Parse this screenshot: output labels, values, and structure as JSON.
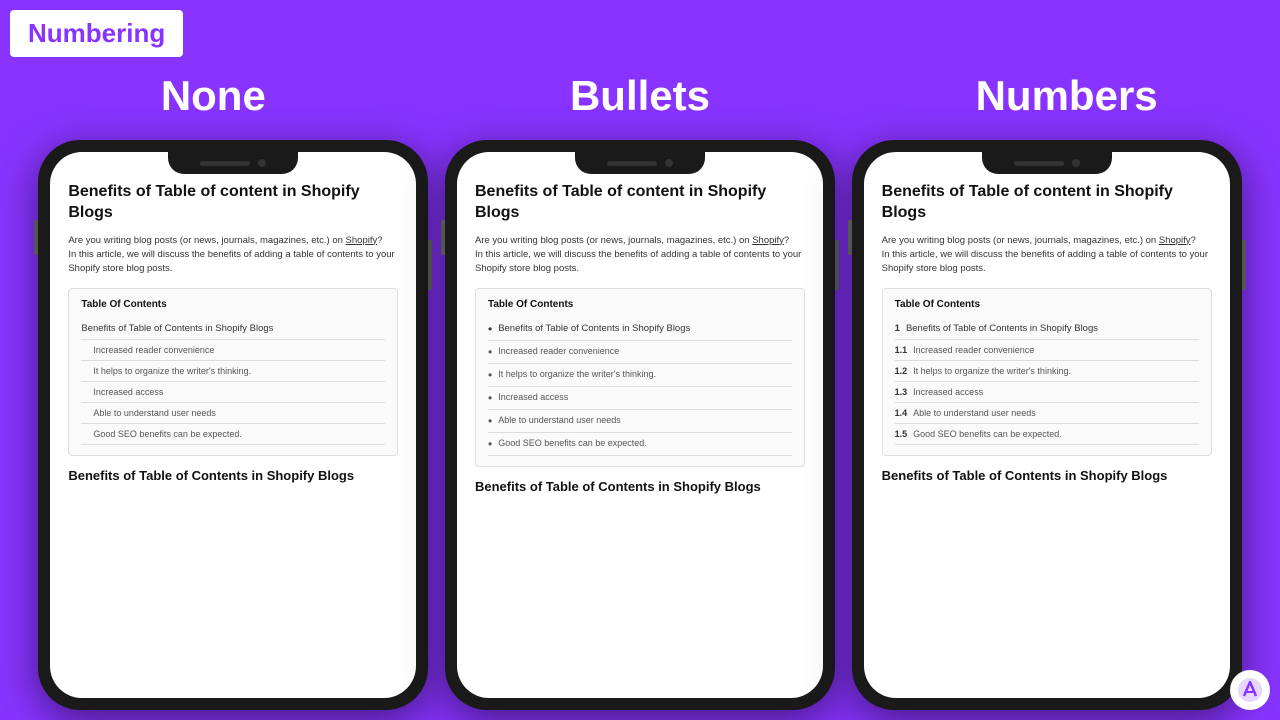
{
  "header": {
    "badge": "Numbering"
  },
  "columns": [
    {
      "title": "None"
    },
    {
      "title": "Bullets"
    },
    {
      "title": "Numbers"
    }
  ],
  "phone_content": {
    "article_title": "Benefits of Table of content in Shopify Blogs",
    "intro_line1": "Are you writing blog posts (or news, journals, magazines, etc.) on",
    "intro_link": "Shopify",
    "intro_line2": "?",
    "intro_line3": "In this article, we will discuss the benefits of adding a table of contents to your Shopify store blog posts.",
    "toc_title": "Table Of Contents",
    "toc_main_item": "Benefits of Table of Contents in Shopify Blogs",
    "toc_sub_items": [
      "Increased reader convenience",
      "It helps to organize the writer's thinking.",
      "Increased access",
      "Able to understand user needs",
      "Good SEO benefits can be expected."
    ],
    "section_heading": "Benefits of Table of Contents in Shopify Blogs"
  },
  "numbers_prefixes": {
    "main": "1",
    "subs": [
      "1.1",
      "1.2",
      "1.3",
      "1.4",
      "1.5"
    ]
  }
}
